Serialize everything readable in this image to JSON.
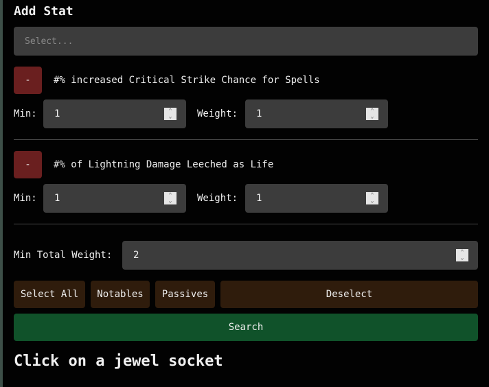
{
  "title": "Add Stat",
  "select": {
    "placeholder": "Select..."
  },
  "remove_label": "-",
  "stats": [
    {
      "text": "#% increased Critical Strike Chance for Spells",
      "min_label": "Min:",
      "min": "1",
      "weight_label": "Weight:",
      "weight": "1"
    },
    {
      "text": "#% of Lightning Damage Leeched as Life",
      "min_label": "Min:",
      "min": "1",
      "weight_label": "Weight:",
      "weight": "1"
    }
  ],
  "min_total_weight": {
    "label": "Min Total Weight:",
    "value": "2"
  },
  "buttons": {
    "select_all": "Select All",
    "notables": "Notables",
    "passives": "Passives",
    "deselect": "Deselect",
    "search": "Search"
  },
  "footer": "Click on a jewel socket"
}
